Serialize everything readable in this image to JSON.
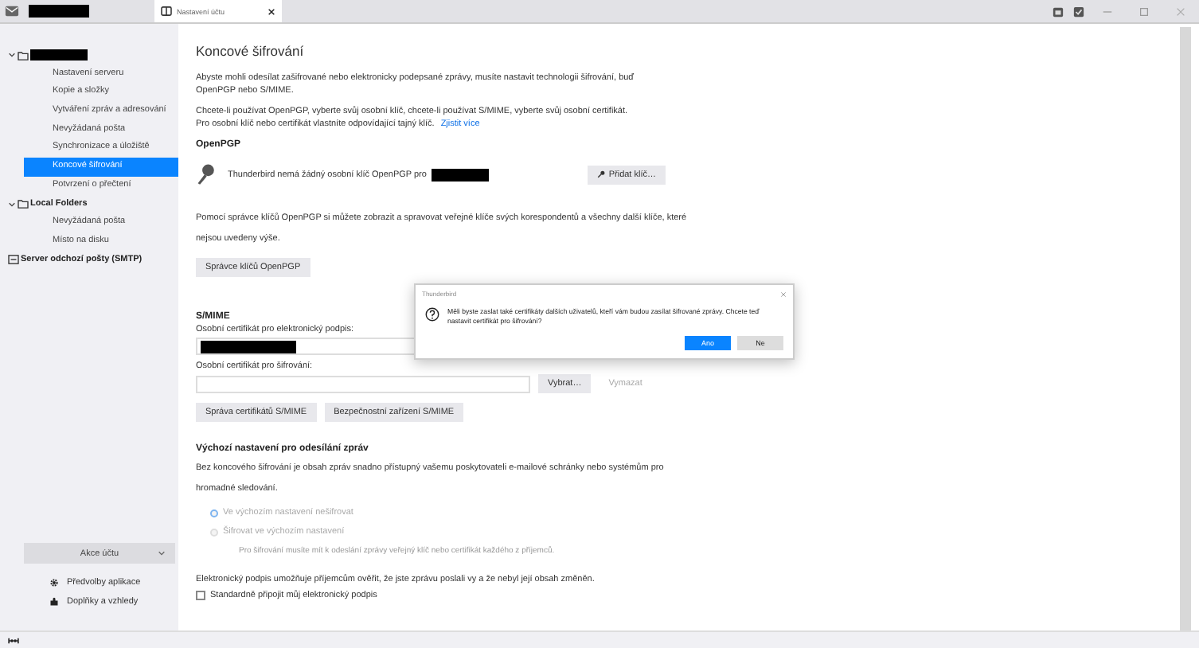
{
  "tabs": [
    {
      "kind": "redacted",
      "selected": false
    },
    {
      "kind": "settings",
      "label": "Nastavení účtu",
      "selected": true
    }
  ],
  "sidebar": {
    "groups": [
      {
        "kind": "redacted",
        "expanded": true,
        "children": [
          {
            "label": "Nastavení serveru",
            "selected": false
          },
          {
            "label": "Kopie a složky",
            "selected": false
          },
          {
            "label": "Vytváření zpráv a adresování",
            "selected": false
          },
          {
            "label": "Nevyžádaná pošta",
            "selected": false
          },
          {
            "label": "Synchronizace a úložiště",
            "selected": false
          },
          {
            "label": "Koncové šifrování",
            "selected": true
          },
          {
            "label": "Potvrzení o přečtení",
            "selected": false
          }
        ]
      },
      {
        "kind": "folder",
        "label": "Local Folders",
        "expanded": true,
        "children": [
          {
            "label": "Nevyžádaná pošta",
            "selected": false
          },
          {
            "label": "Místo na disku",
            "selected": false
          }
        ]
      },
      {
        "kind": "server",
        "label": "Server odchozí pošty (SMTP)"
      }
    ],
    "account_actions": "Akce účtu",
    "links": [
      {
        "kind": "gear",
        "label": "Předvolby aplikace"
      },
      {
        "kind": "puzzle",
        "label": "Doplňky a vzhledy"
      }
    ]
  },
  "content": {
    "title": "Koncové šifrování",
    "intro": "Abyste mohli odesílat zašifrované nebo elektronicky podepsané zprávy, musíte nastavit technologii šifrování, buď OpenPGP nebo S/MIME.",
    "intro_2": "Chcete-li používat OpenPGP, vyberte svůj osobní klíč, chcete-li používat S/MIME, vyberte svůj osobní certifikát.",
    "intro_3": "Pro osobní klíč nebo certifikát vlastníte odpovídající tajný klíč.",
    "learn_more": "Zjistit více",
    "openpgp": {
      "heading": "OpenPGP",
      "no_key": "Thunderbird nemá žádný osobní klíč OpenPGP pro",
      "add_key": "Přidat klíč…",
      "info": "Pomocí správce klíčů OpenPGP si můžete zobrazit a spravovat veřejné klíče svých korespondentů a všechny další klíče, které nejsou uvedeny výše.",
      "manager": "Správce klíčů OpenPGP"
    },
    "smime": {
      "heading": "S/MIME",
      "sign_label": "Osobní certifikát pro elektronický podpis:",
      "encrypt_label": "Osobní certifikát pro šifrování:",
      "select": {
        "label": "Vybrat…",
        "disabled": false
      },
      "clear": {
        "label": "Vymazat",
        "disabled": true
      },
      "manage": "Správa certifikátů S/MIME",
      "devices": "Bezpečnostní zařízení S/MIME"
    },
    "defaults": {
      "heading": "Výchozí nastavení pro odesílání zpráv",
      "info": "Bez koncového šifrování je obsah zpráv snadno přístupný vašemu poskytovateli e-mailové schránky nebo systémům pro hromadné sledování.",
      "options": [
        {
          "label": "Ve výchozím nastavení nešifrovat",
          "selected": true,
          "disabled": true
        },
        {
          "label": "Šifrovat ve výchozím nastavení",
          "selected": false,
          "disabled": true
        }
      ],
      "note": "Pro šifrování musíte mít k odeslání zprávy veřejný klíč nebo certifikát každého z příjemců.",
      "signature_info": "Elektronický podpis umožňuje příjemcům ověřit, že jste zprávu poslali vy a že nebyl její obsah změněn.",
      "signature": {
        "label": "Standardně připojit můj elektronický podpis",
        "checked": false
      }
    }
  },
  "dialog": {
    "title": "Thunderbird",
    "message": "Měli byste zaslat také certifikáty dalších uživatelů, kteří vám budou zasílat šifrované zprávy. Chcete teď nastavit certifikát pro šifrování?",
    "buttons": [
      {
        "label": "Ano",
        "primary": true
      },
      {
        "label": "Ne",
        "primary": false
      }
    ]
  }
}
